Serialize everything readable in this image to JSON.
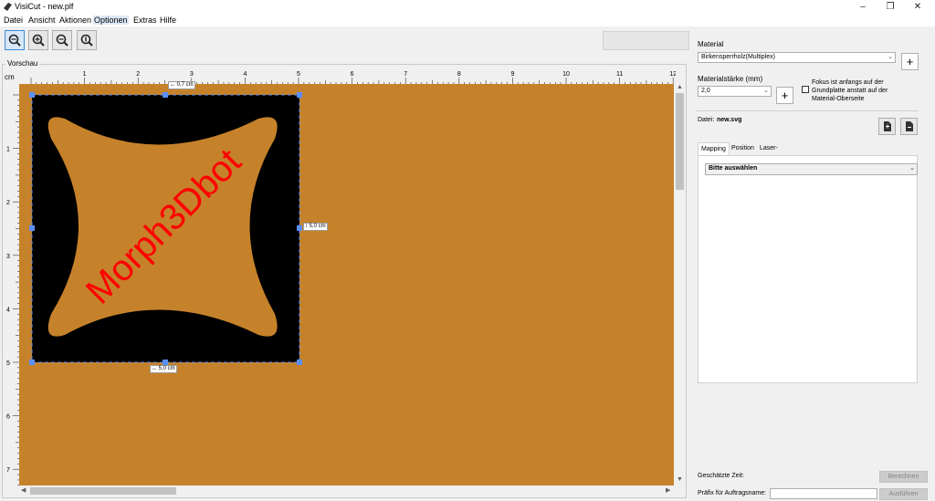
{
  "window": {
    "title": "VisiCut - new.plf",
    "controls": {
      "minimize": "–",
      "maximize": "❐",
      "close": "✕"
    }
  },
  "menu": {
    "items": [
      "Datei",
      "Ansicht",
      "Aktionen",
      "Optionen",
      "Extras",
      "Hilfe"
    ],
    "active": "Optionen"
  },
  "toolbar": {
    "buttons": [
      "zoom-fit-icon",
      "zoom-in-icon",
      "zoom-out-icon",
      "zoom-reset-icon"
    ]
  },
  "preview": {
    "label": "Vorschau",
    "unit": "cm",
    "ruler_x": [
      "1",
      "2",
      "3",
      "4",
      "5",
      "6",
      "7",
      "8",
      "9",
      "10",
      "11",
      "12"
    ],
    "ruler_y": [
      "1",
      "2",
      "3",
      "4",
      "5",
      "6",
      "7"
    ],
    "object": {
      "text": "Morph3Dbot",
      "width_label": "↔ 5,0 cm",
      "height_label": "↕ 5,0 cm",
      "top_label": "↔ 0,7 cm"
    },
    "colors": {
      "material": "#c6822a",
      "shape_bg": "#000000",
      "shape_fill": "#c6822a",
      "text": "#ff0000",
      "handle": "#5b8ef5"
    }
  },
  "panel": {
    "material_label": "Material",
    "material_value": "Birkensperrholz(Multiplex)",
    "thickness_label": "Materialstärke (mm)",
    "thickness_value": "2,0",
    "focus_text": "Fokus ist anfangs auf der Grundplatte anstatt auf der Material-Oberseite",
    "file_label": "Datei:",
    "file_name": "new.svg",
    "tabs": [
      "Mapping",
      "Position",
      "Laser-Einstellungen"
    ],
    "active_tab": "Mapping",
    "mapping_value": "Bitte auswählen",
    "time_label": "Geschätzte Zeit:",
    "calc_button": "Berechnen",
    "prefix_label": "Präfix für Auftragsname:",
    "run_button": "Ausführen"
  }
}
